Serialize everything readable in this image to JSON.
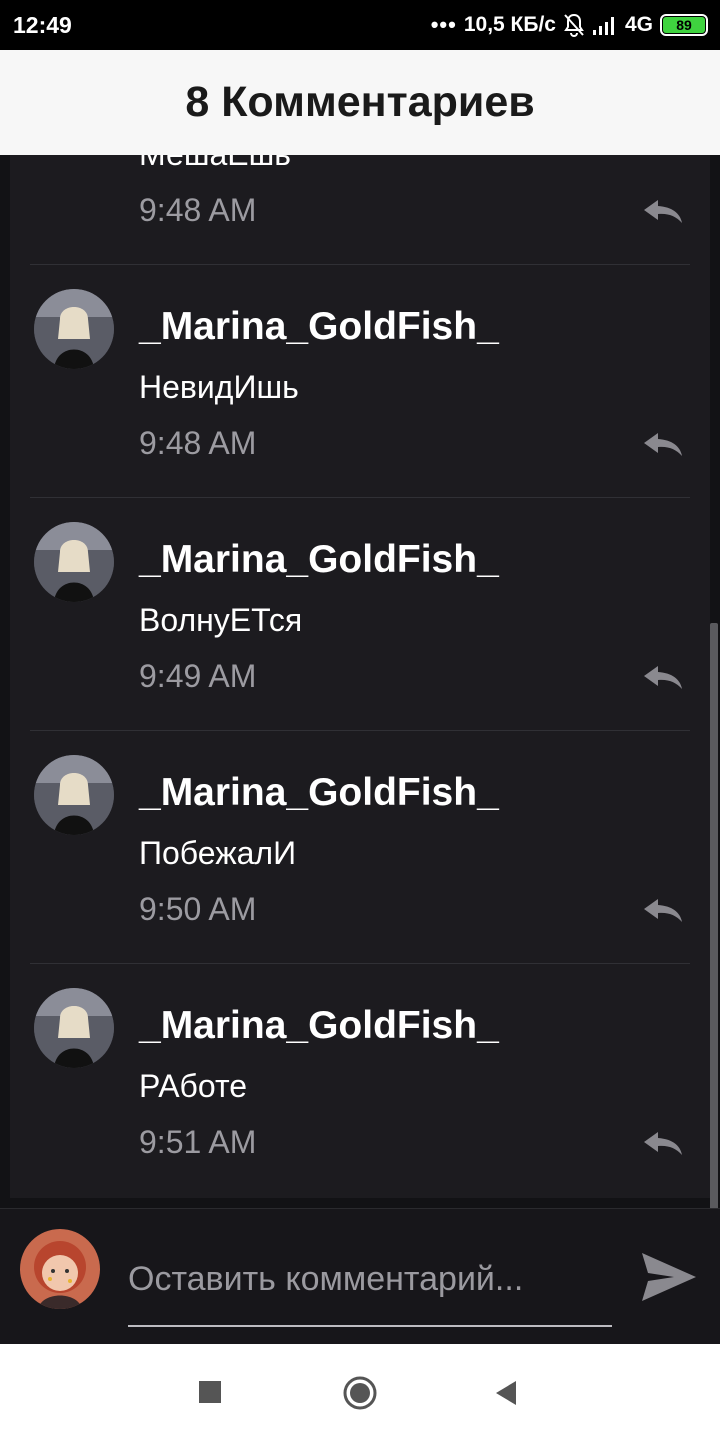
{
  "status_bar": {
    "time": "12:49",
    "speed": "10,5 КБ/с",
    "network": "4G",
    "battery": "89",
    "battery_color": "#3fd33f"
  },
  "header": {
    "title": "8 Комментариев"
  },
  "partial_comment": {
    "text": "МешаЕшь",
    "time": "9:48 AM"
  },
  "comments": [
    {
      "username": "_Marina_GoldFish_",
      "text": "НевидИшь",
      "time": "9:48 AM"
    },
    {
      "username": "_Marina_GoldFish_",
      "text": "ВолнуЕТся",
      "time": "9:49 AM"
    },
    {
      "username": "_Marina_GoldFish_",
      "text": "ПобежалИ",
      "time": "9:50 AM"
    },
    {
      "username": "_Marina_GoldFish_",
      "text": "РАботе",
      "time": "9:51 AM"
    }
  ],
  "input": {
    "placeholder": "Оставить комментарий..."
  },
  "icons": {
    "reply": "reply-icon",
    "send": "send-icon",
    "nav_recents": "square-icon",
    "nav_home": "circle-icon",
    "nav_back": "triangle-back-icon"
  }
}
